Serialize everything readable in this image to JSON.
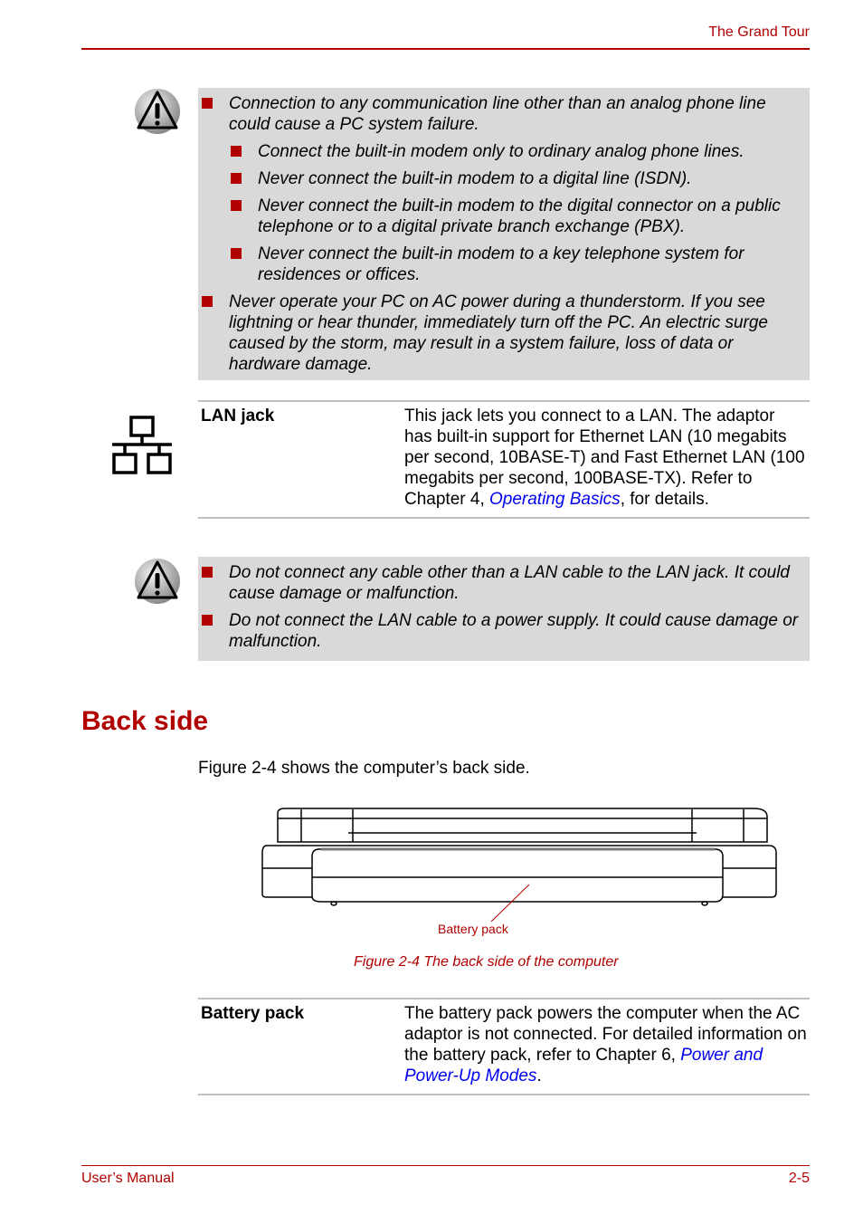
{
  "header": {
    "title": "The Grand Tour"
  },
  "caution1": {
    "icon": "warning-icon",
    "items": [
      {
        "level": 1,
        "text": "Connection to any communication line other than an analog phone line could cause a PC system failure."
      },
      {
        "level": 2,
        "text": "Connect the built-in modem only to ordinary analog phone lines."
      },
      {
        "level": 2,
        "text": "Never connect the built-in modem to a digital line (ISDN)."
      },
      {
        "level": 2,
        "text": "Never connect the built-in modem to the digital connector on a public telephone or to a digital private branch exchange (PBX)."
      },
      {
        "level": 2,
        "text": "Never connect the built-in modem to a key telephone system for residences or offices."
      },
      {
        "level": 1,
        "text": "Never operate your PC on AC power during a thunderstorm. If you see lightning or hear thunder, immediately turn off the PC. An electric surge caused by the storm, may result in a system failure, loss of data or hardware damage."
      }
    ]
  },
  "lan": {
    "icon": "network-icon",
    "term": "LAN jack",
    "desc_before": "This jack lets you connect to a LAN. The adaptor has built-in support for Ethernet LAN (10 megabits per second, 10BASE-T) and Fast Ethernet LAN (100 megabits per second, 100BASE-TX). Refer to Chapter 4, ",
    "link": "Operating Basics",
    "desc_after": ", for details."
  },
  "caution2": {
    "icon": "warning-icon",
    "items": [
      {
        "level": 1,
        "text": "Do not connect any cable other than a LAN cable to the LAN jack. It could cause damage or malfunction."
      },
      {
        "level": 1,
        "text": "Do not connect the LAN cable to a power supply. It could cause damage or malfunction."
      }
    ]
  },
  "section": {
    "title": "Back side",
    "intro": "Figure 2-4 shows the computer’s back side.",
    "figure_label": "Battery pack",
    "figure_caption": "Figure 2-4 The back side of the computer"
  },
  "battery": {
    "term": "Battery pack",
    "desc_before": "The battery pack powers the computer when the AC adaptor is not connected. For detailed information on the battery pack, refer to Chapter 6, ",
    "link": "Power and Power-Up Modes",
    "desc_after": "."
  },
  "footer": {
    "left": "User’s Manual",
    "right": "2-5"
  },
  "colors": {
    "accent": "#b00000",
    "link": "#0000ee",
    "note_bg": "#d9d9d9",
    "rule": "#c0c0c0"
  }
}
